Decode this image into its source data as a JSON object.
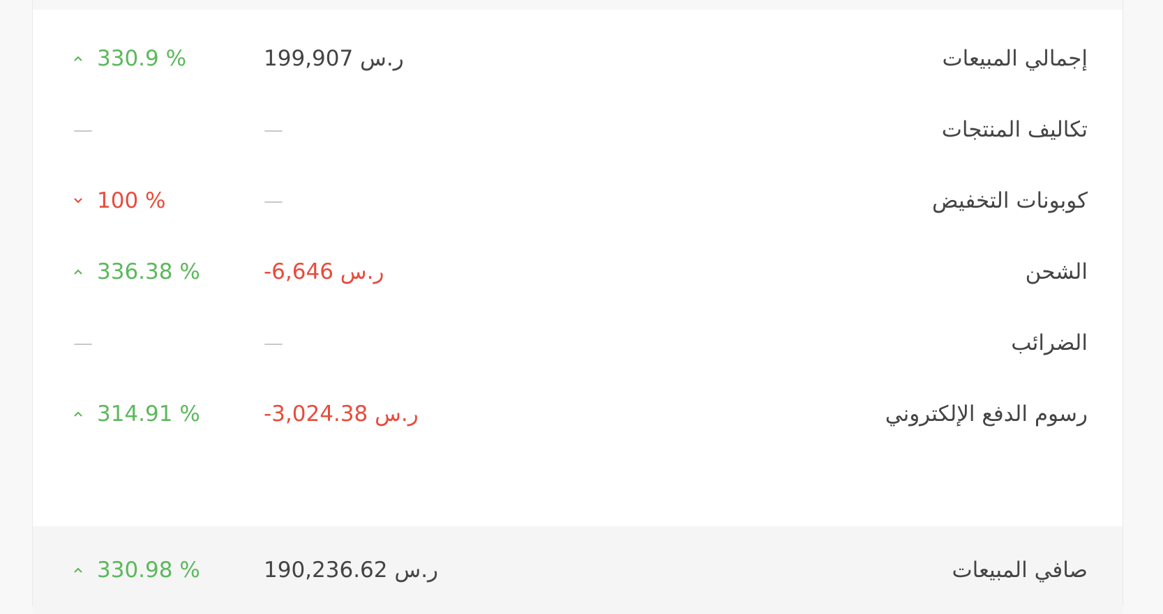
{
  "rows": [
    {
      "label": "إجمالي المبيعات",
      "value": "199,907 ر.س",
      "value_type": "normal",
      "change": "330.9 %",
      "change_dir": "up"
    },
    {
      "label": "تكاليف المنتجات",
      "value": "—",
      "value_type": "dash",
      "change": "—",
      "change_dir": "none"
    },
    {
      "label": "كوبونات التخفيض",
      "value": "—",
      "value_type": "dash",
      "change": "100 %",
      "change_dir": "down"
    },
    {
      "label": "الشحن",
      "value": "-6,646 ر.س",
      "value_type": "neg",
      "change": "336.38 %",
      "change_dir": "up"
    },
    {
      "label": "الضرائب",
      "value": "—",
      "value_type": "dash",
      "change": "—",
      "change_dir": "none"
    },
    {
      "label": "رسوم الدفع الإلكتروني",
      "value": "-3,024.38 ر.س",
      "value_type": "neg",
      "change": "314.91 %",
      "change_dir": "up"
    }
  ],
  "total": {
    "label": "صافي المبيعات",
    "value": "190,236.62 ر.س",
    "change": "330.98 %",
    "change_dir": "up"
  },
  "colors": {
    "up": "#5cb85c",
    "down": "#e74c3c",
    "negative": "#e74c3c",
    "text": "#444444"
  },
  "icons": {
    "up": "chevron-up-icon",
    "down": "chevron-down-icon"
  }
}
